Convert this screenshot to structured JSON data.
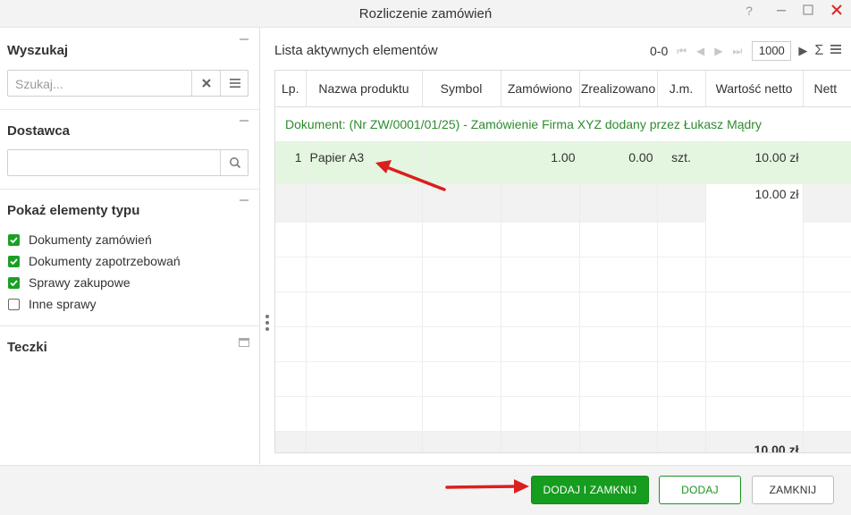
{
  "window": {
    "title": "Rozliczenie zamówień",
    "help_icon": "?",
    "min_icon": "minimize-icon",
    "max_icon": "maximize-icon",
    "close_icon": "close-icon"
  },
  "sidebar": {
    "search": {
      "title": "Wyszukaj",
      "placeholder": "Szukaj..."
    },
    "supplier": {
      "title": "Dostawca",
      "value": ""
    },
    "types": {
      "title": "Pokaż elementy typu",
      "items": [
        {
          "label": "Dokumenty zamówień",
          "checked": true
        },
        {
          "label": "Dokumenty zapotrzebowań",
          "checked": true
        },
        {
          "label": "Sprawy zakupowe",
          "checked": true
        },
        {
          "label": "Inne sprawy",
          "checked": false
        }
      ]
    },
    "folders": {
      "title": "Teczki"
    }
  },
  "list": {
    "title": "Lista aktywnych elementów",
    "pager": {
      "range": "0-0",
      "page_size": "1000"
    },
    "columns": [
      "Lp.",
      "Nazwa produktu",
      "Symbol",
      "Zamówiono",
      "Zrealizowano",
      "J.m.",
      "Wartość netto",
      "Nett"
    ],
    "document_row": "Dokument: (Nr ZW/0001/01/25) - Zamówienie Firma XYZ dodany przez Łukasz Mądry",
    "rows": [
      {
        "lp": "1",
        "name": "Papier A3",
        "symbol": "",
        "ordered": "1.00",
        "realized": "0.00",
        "unit": "szt.",
        "net_value": "10.00 zł"
      }
    ],
    "subtotal": "10.00 zł",
    "total": "10.00 zł"
  },
  "footer": {
    "add_close": "DODAJ I ZAMKNIJ",
    "add": "DODAJ",
    "close": "ZAMKNIJ"
  },
  "colors": {
    "accent_green": "#169c1f",
    "annotation_red": "#d9201e"
  }
}
